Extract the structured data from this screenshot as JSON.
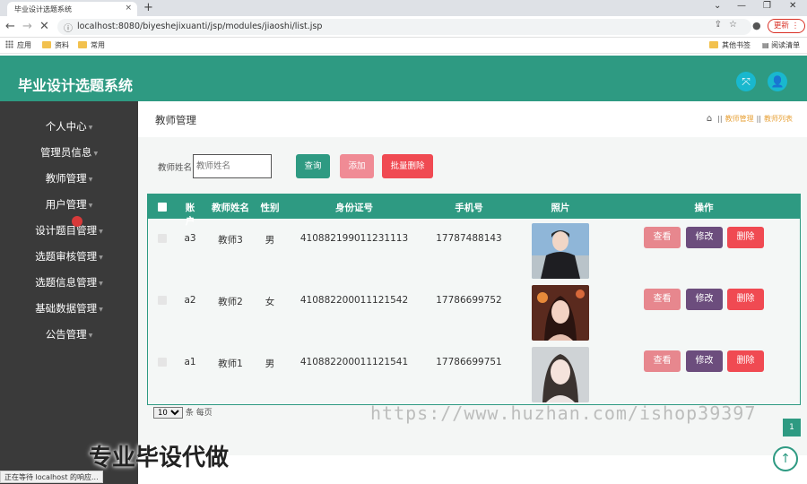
{
  "browser": {
    "tab_title": "毕业设计选题系统",
    "tab_close": "×",
    "new_tab": "+",
    "url": "localhost:8080/biyeshejixuanti/jsp/modules/jiaoshi/list.jsp",
    "update_label": "更新",
    "bookmarks": [
      "应用",
      "资料",
      "常用"
    ],
    "bookmarks_right": [
      "其他书签",
      "阅读清单"
    ],
    "status": "正在等待 localhost 的响应..."
  },
  "app": {
    "title": "毕业设计选题系统"
  },
  "sidebar": {
    "items": [
      {
        "label": "个人中心"
      },
      {
        "label": "管理员信息"
      },
      {
        "label": "教师管理"
      },
      {
        "label": "用户管理"
      },
      {
        "label": "设计题目管理"
      },
      {
        "label": "选题审核管理"
      },
      {
        "label": "选题信息管理"
      },
      {
        "label": "基础数据管理"
      },
      {
        "label": "公告管理"
      }
    ]
  },
  "page": {
    "title": "教师管理",
    "breadcrumb": [
      "教师管理",
      "教师列表"
    ]
  },
  "search": {
    "label": "教师姓名",
    "placeholder": "教师姓名",
    "query_label": "查询",
    "add_label": "添加",
    "bulk_delete_label": "批量删除"
  },
  "table": {
    "headers": [
      "账户",
      "教师姓名",
      "性别",
      "身份证号",
      "手机号",
      "照片",
      "操作"
    ],
    "rows": [
      {
        "account": "a3",
        "name": "教师3",
        "gender": "男",
        "id_number": "410882199011231113",
        "phone": "17787488143"
      },
      {
        "account": "a2",
        "name": "教师2",
        "gender": "女",
        "id_number": "410882200011121542",
        "phone": "17786699752"
      },
      {
        "account": "a1",
        "name": "教师1",
        "gender": "男",
        "id_number": "410882200011121541",
        "phone": "17786699751"
      }
    ],
    "actions": {
      "view": "查看",
      "edit": "修改",
      "delete": "删除"
    }
  },
  "pagination": {
    "page_size": "10",
    "per_page_label": "条 每页",
    "current_page": "1"
  },
  "watermarks": {
    "url": "https://www.huzhan.com/ishop39397",
    "text": "专业毕设代做"
  },
  "colors": {
    "primary": "#2e9a82",
    "sidebar": "#3a3a3a",
    "view": "#e7878e",
    "edit": "#6c4d7d",
    "delete": "#f04a52"
  }
}
